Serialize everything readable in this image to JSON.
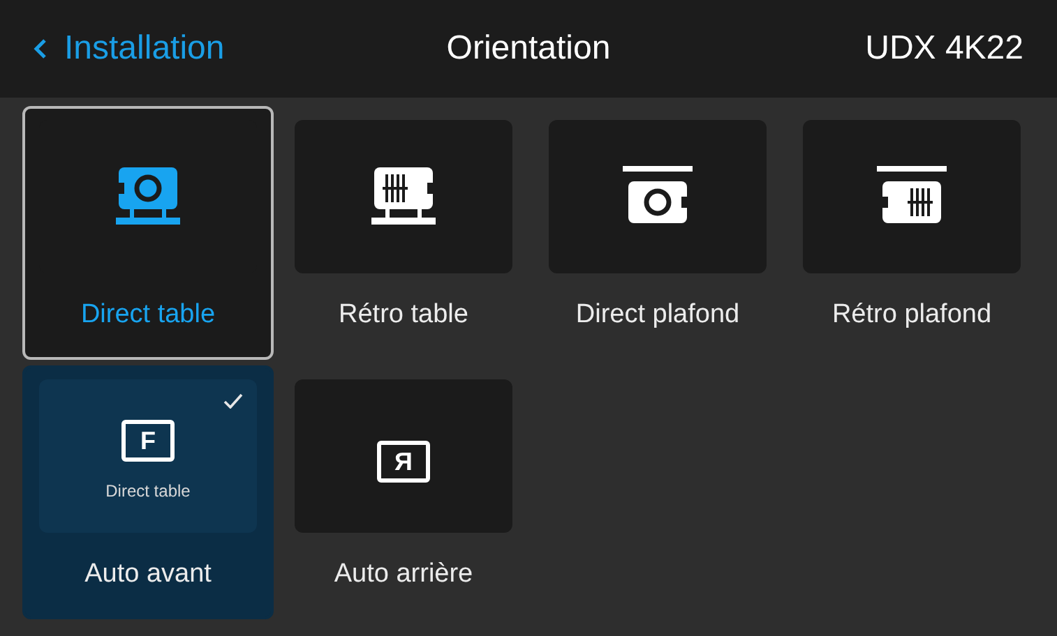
{
  "header": {
    "back_label": "Installation",
    "title": "Orientation",
    "model": "UDX 4K22"
  },
  "items": [
    {
      "kind": "table",
      "label": "Direct table",
      "focused": true,
      "active": true,
      "checked": false
    },
    {
      "kind": "rear",
      "label": "Rétro table",
      "focused": false,
      "active": false,
      "checked": false
    },
    {
      "kind": "ceiling",
      "label": "Direct plafond",
      "focused": false,
      "active": false,
      "checked": false
    },
    {
      "kind": "rearceiling",
      "label": "Rétro plafond",
      "focused": false,
      "active": false,
      "checked": false
    },
    {
      "kind": "auto",
      "glyph": "F",
      "sublabel": "Direct table",
      "label": "Auto avant",
      "focused": false,
      "active": false,
      "checked": true
    },
    {
      "kind": "auto",
      "glyph": "Я",
      "label": "Auto arrière",
      "focused": false,
      "active": false,
      "checked": false
    }
  ]
}
